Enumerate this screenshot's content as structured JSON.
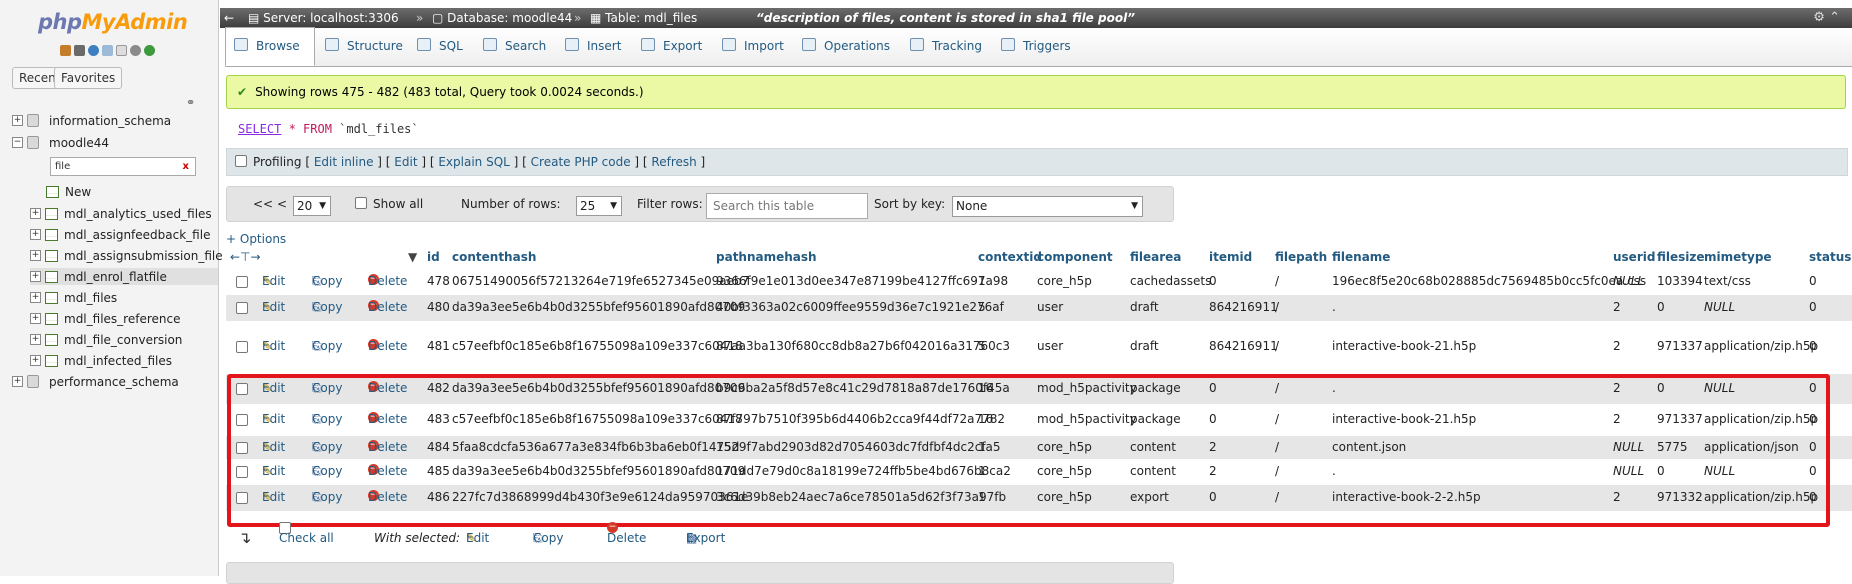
{
  "logo": {
    "php": "php",
    "myadmin": "MyAdmin"
  },
  "sidebar": {
    "recent": "Recent",
    "favorites": "Favorites",
    "filter_value": "file",
    "tree": [
      {
        "label": "information_schema",
        "type": "db"
      },
      {
        "label": "moodle44",
        "type": "db"
      },
      {
        "label": "New",
        "type": "new"
      },
      {
        "label": "mdl_analytics_used_files",
        "type": "table"
      },
      {
        "label": "mdl_assignfeedback_file",
        "type": "table"
      },
      {
        "label": "mdl_assignsubmission_file",
        "type": "table"
      },
      {
        "label": "mdl_enrol_flatfile",
        "type": "table"
      },
      {
        "label": "mdl_files",
        "type": "table"
      },
      {
        "label": "mdl_files_reference",
        "type": "table"
      },
      {
        "label": "mdl_file_conversion",
        "type": "table"
      },
      {
        "label": "mdl_infected_files",
        "type": "table"
      },
      {
        "label": "performance_schema",
        "type": "db"
      }
    ]
  },
  "breadcrumb": {
    "server": "Server: localhost:3306",
    "database": "Database: moodle44",
    "table": "Table: mdl_files",
    "comment": "“description of files, content is stored in sha1 file pool”"
  },
  "tabs": [
    "Browse",
    "Structure",
    "SQL",
    "Search",
    "Insert",
    "Export",
    "Import",
    "Operations",
    "Tracking",
    "Triggers"
  ],
  "message": "Showing rows 475 - 482 (483 total, Query took 0.0024 seconds.)",
  "sql": {
    "keyword": "SELECT",
    "rest": " * FROM ",
    "table": "`mdl_files`"
  },
  "profiling": {
    "label": "Profiling",
    "edit_inline": "Edit inline",
    "edit": "Edit",
    "explain": "Explain SQL",
    "php": "Create PHP code",
    "refresh": "Refresh"
  },
  "nav": {
    "first": "<<",
    "prev": "<",
    "page": "20",
    "show_all": "Show all",
    "rows_label": "Number of rows:",
    "rows": "25",
    "filter_label": "Filter rows:",
    "filter_placeholder": "Search this table",
    "sort_label": "Sort by key:",
    "sort_value": "None"
  },
  "options_link": "+ Options",
  "columns": [
    "id",
    "contenthash",
    "pathnamehash",
    "contextid",
    "component",
    "filearea",
    "itemid",
    "filepath",
    "filename",
    "userid",
    "filesize",
    "mimetype",
    "status"
  ],
  "actions": {
    "edit": "Edit",
    "copy": "Copy",
    "delete": "Delete"
  },
  "rows": [
    {
      "id": "478",
      "contenthash": "06751490056f57213264e719fe6527345e09aeb7",
      "pathnamehash": "9366f9e1e013d0ee347e87199be4127ffc697a98",
      "contextid": "1",
      "component": "core_h5p",
      "filearea": "cachedassets",
      "itemid": "0",
      "filepath": "/",
      "filename": "196ec8f5e20c68b028885dc7569485b0cc5fc0ea.css",
      "userid": "NULL",
      "filesize": "103394",
      "mimetype": "text/css",
      "status": "0"
    },
    {
      "id": "480",
      "contenthash": "da39a3ee5e6b4b0d3255bfef95601890afd80709",
      "pathnamehash": "40bf3363a02c6009ffee9559d36e7c1921e276af",
      "contextid": "5",
      "component": "user",
      "filearea": "draft",
      "itemid": "864216911",
      "filepath": "/",
      "filename": ".",
      "userid": "2",
      "filesize": "0",
      "mimetype": "NULL",
      "status": "0"
    },
    {
      "id": "481",
      "contenthash": "c57eefbf0c185e6b8f16755098a109e337c60418",
      "pathnamehash": "87aa3ba130f680cc8db8a27b6f042016a31760c3",
      "contextid": "5",
      "component": "user",
      "filearea": "draft",
      "itemid": "864216911",
      "filepath": "/",
      "filename": "interactive-book-21.h5p",
      "userid": "2",
      "filesize": "971337",
      "mimetype": "application/zip.h5p",
      "status": "0"
    },
    {
      "id": "482",
      "contenthash": "da39a3ee5e6b4b0d3255bfef95601890afd80709",
      "pathnamehash": "b9c6ba2a5f8d57e8c41c29d7818a87de1760f45a",
      "contextid": "16",
      "component": "mod_h5pactivity",
      "filearea": "package",
      "itemid": "0",
      "filepath": "/",
      "filename": ".",
      "userid": "2",
      "filesize": "0",
      "mimetype": "NULL",
      "status": "0"
    },
    {
      "id": "483",
      "contenthash": "c57eefbf0c185e6b8f16755098a109e337c60418",
      "pathnamehash": "87f797b7510f395b6d4406b2cca9f44df72a7782",
      "contextid": "16",
      "component": "mod_h5pactivity",
      "filearea": "package",
      "itemid": "0",
      "filepath": "/",
      "filename": "interactive-book-21.h5p",
      "userid": "2",
      "filesize": "971337",
      "mimetype": "application/zip.h5p",
      "status": "0"
    },
    {
      "id": "484",
      "contenthash": "5faa8cdcfa536a677a3e834fb6b3ba6eb0f1475d",
      "pathnamehash": "1529f7abd2903d82d7054603dc7fdfbf4dc2cfa5",
      "contextid": "1",
      "component": "core_h5p",
      "filearea": "content",
      "itemid": "2",
      "filepath": "/",
      "filename": "content.json",
      "userid": "NULL",
      "filesize": "5775",
      "mimetype": "application/json",
      "status": "0"
    },
    {
      "id": "485",
      "contenthash": "da39a3ee5e6b4b0d3255bfef95601890afd80709",
      "pathnamehash": "171dd7e79d0c8a18199e724ffb5be4bd676b8ca2",
      "contextid": "1",
      "component": "core_h5p",
      "filearea": "content",
      "itemid": "2",
      "filepath": "/",
      "filename": ".",
      "userid": "NULL",
      "filesize": "0",
      "mimetype": "NULL",
      "status": "0"
    },
    {
      "id": "486",
      "contenthash": "227fc7d3868999d4b430f3e9e6124da95970361e",
      "pathnamehash": "3c6d39b8eb24aec7a6ce78501a5d62f3f73a97fb",
      "contextid": "1",
      "component": "core_h5p",
      "filearea": "export",
      "itemid": "0",
      "filepath": "/",
      "filename": "interactive-book-2-2.h5p",
      "userid": "2",
      "filesize": "971332",
      "mimetype": "application/zip.h5p",
      "status": "0"
    }
  ],
  "bottom": {
    "check_all": "Check all",
    "with_selected": "With selected:",
    "edit": "Edit",
    "copy": "Copy",
    "delete": "Delete",
    "export": "Export"
  }
}
